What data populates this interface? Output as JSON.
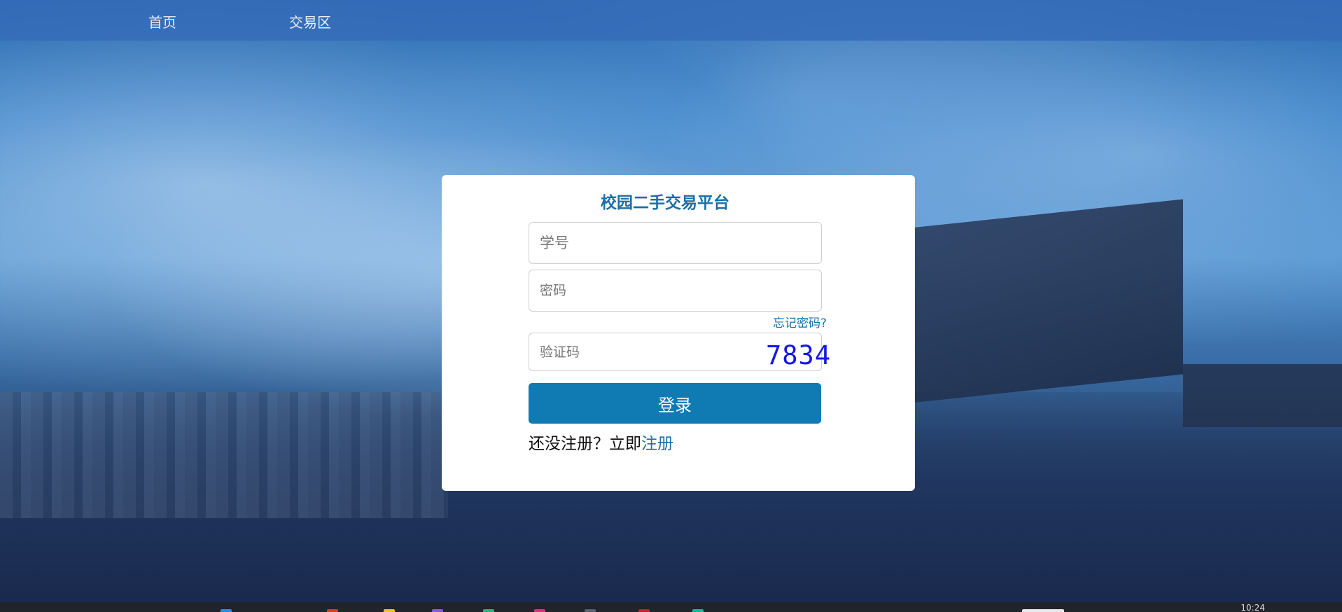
{
  "nav": {
    "home": "首页",
    "trade": "交易区"
  },
  "login": {
    "title": "校园二手交易平台",
    "username_placeholder": "学号",
    "password_placeholder": "密码",
    "forgot": "忘记密码?",
    "captcha_placeholder": "验证码",
    "captcha_code": "7834",
    "submit": "登录",
    "register_prompt": "还没注册？立即",
    "register_link": "注册"
  },
  "taskbar": {
    "clock": "10:24"
  },
  "colors": {
    "accent": "#0f7bb2",
    "title": "#1a6fa6",
    "captcha": "#1616e6",
    "nav_bg": "#366cba"
  }
}
